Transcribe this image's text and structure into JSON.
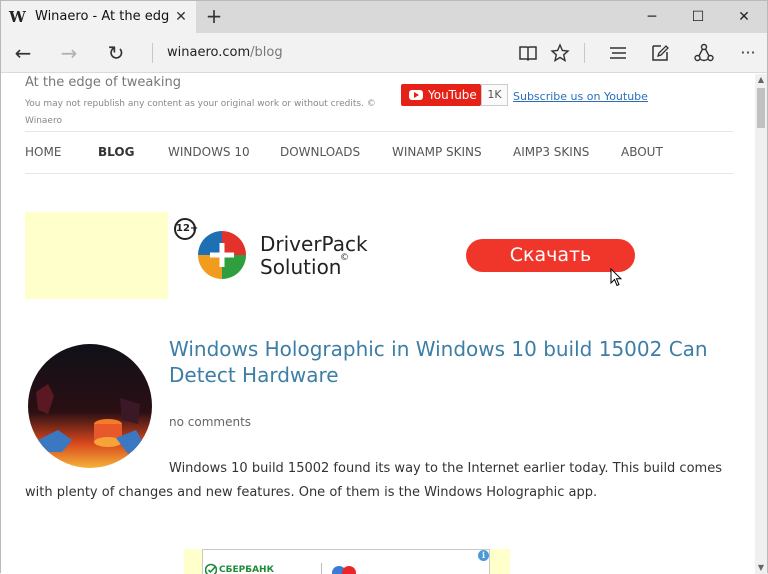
{
  "browser": {
    "tab": {
      "favicon": "W",
      "title": "Winaero - At the edge o",
      "close_glyph": "✕"
    },
    "new_tab_glyph": "+",
    "window_controls": {
      "minimize_glyph": "─",
      "maximize_glyph": "☐",
      "close_glyph": "✕"
    },
    "nav": {
      "back_glyph": "←",
      "forward_glyph": "→",
      "refresh_glyph": "↻"
    },
    "address": {
      "host": "winaero.com",
      "path": "/blog"
    },
    "toolbar_icons": [
      "reading-view-icon",
      "favorite-star-icon",
      "hub-icon",
      "web-note-icon",
      "share-icon",
      "more-icon"
    ],
    "toolbar_glyphs": {
      "more": "···"
    }
  },
  "site": {
    "tagline": "At the edge of tweaking",
    "notice": "You may not republish any content as your original work or without credits. © Winaero",
    "youtube": {
      "label": "YouTube",
      "count": "1K",
      "subscribe": "Subscribe us on Youtube"
    },
    "menu": [
      {
        "label": "HOME",
        "active": false
      },
      {
        "label": "BLOG",
        "active": true
      },
      {
        "label": "WINDOWS 10",
        "active": false
      },
      {
        "label": "DOWNLOADS",
        "active": false
      },
      {
        "label": "WINAMP SKINS",
        "active": false
      },
      {
        "label": "AIMP3 SKINS",
        "active": false
      },
      {
        "label": "ABOUT",
        "active": false
      }
    ]
  },
  "ad": {
    "age_rating": "12+",
    "brand_line1": "DriverPack",
    "brand_line2": "Solution",
    "registered": "©",
    "cta": "Скачать"
  },
  "post": {
    "title": "Windows Holographic in Windows 10 build 15002 Can Detect Hardware",
    "comments": "no comments",
    "excerpt": "Windows 10 build 15002 found its way to the Internet earlier today. This build comes with plenty of changes and new features. One of them is the Windows Holographic app."
  },
  "ad2": {
    "text": "СБЕРБАНК",
    "info_glyph": "i"
  },
  "colors": {
    "youtube_red": "#e62117",
    "cta_red": "#f0352b",
    "link_blue": "#3d7ea6",
    "ad_yellow": "#ffffcc"
  }
}
